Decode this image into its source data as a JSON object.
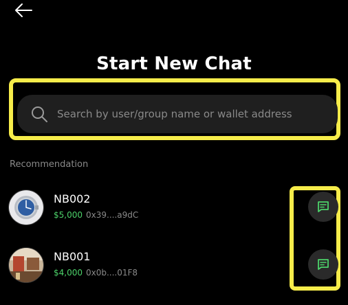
{
  "header": {
    "back_icon": "arrow-left-icon",
    "title": "Start New Chat"
  },
  "search": {
    "icon": "search-icon",
    "placeholder": "Search by user/group name or wallet address",
    "value": ""
  },
  "recommendation": {
    "label": "Recommendation",
    "items": [
      {
        "name": "NB002",
        "amount": "$5,000",
        "address": "0x39....a9dC",
        "avatar": "watch-avatar",
        "action_icon": "chat-bubble-icon"
      },
      {
        "name": "NB001",
        "amount": "$4,000",
        "address": "0x0b....01F8",
        "avatar": "room-avatar",
        "action_icon": "chat-bubble-icon"
      }
    ]
  },
  "colors": {
    "background": "#000000",
    "highlight": "#f6ec4a",
    "amount": "#4cd36a",
    "chat_icon": "#4cd36a",
    "search_bg": "#1f1f1f"
  }
}
